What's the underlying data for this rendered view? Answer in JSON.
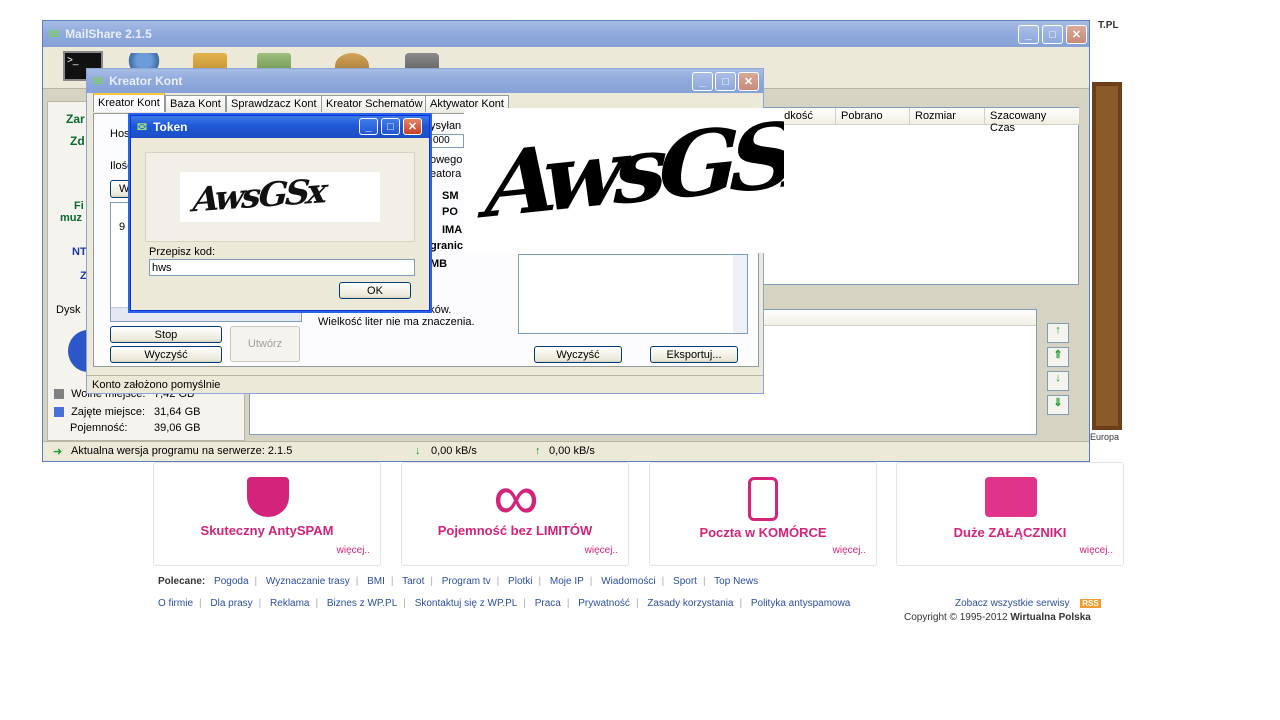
{
  "mailshare": {
    "title": "MailShare 2.1.5",
    "left_panel": {
      "links": [
        "Zar",
        "Zd",
        "Fi",
        "muz",
        "NT",
        "Z"
      ],
      "disk_label": "Dysk",
      "stats": [
        {
          "label": "Wolne miejsce:",
          "value": "7,42 GB",
          "color": "#808080"
        },
        {
          "label": "Zajęte miejsce:",
          "value": "31,64 GB",
          "color": "#4a6fd6"
        },
        {
          "label": "Pojemność:",
          "value": "39,06 GB",
          "color": ""
        }
      ]
    },
    "grid_headers": [
      "Prędkość",
      "Pobrano",
      "Rozmiar",
      "Szacowany Czas"
    ],
    "status": {
      "server_version": "Aktualna wersja programu na serwerze: 2.1.5",
      "download_speed": "0,00 kB/s",
      "upload_speed": "0,00 kB/s"
    }
  },
  "kreator": {
    "title": "Kreator Kont",
    "tabs": [
      "Kreator Kont",
      "Baza Kont",
      "Sprawdzacz Kont",
      "Kreator Schematów",
      "Aktywator Kont"
    ],
    "host_label": "Host",
    "ilosc_label": "Ilość",
    "w_button": "W",
    "row_number": "9",
    "wysylan_label": "ysyłan",
    "counter_value": "000",
    "right_texts": [
      "owego",
      "eatora"
    ],
    "options": [
      "SM",
      "PO",
      "IMA"
    ],
    "granic_label": "granic",
    "mb_label": "MB",
    "info_line1": "Token to zawsze 6 znaków.",
    "info_line2": "Wielkość liter nie ma znaczenia.",
    "buttons": {
      "stop": "Stop",
      "clear": "Wyczyść",
      "create": "Utwórz",
      "clear2": "Wyczyść",
      "export": "Eksportuj..."
    },
    "status_text": "Konto założono pomyślnie"
  },
  "token": {
    "title": "Token",
    "captcha_text": "AwsGSx",
    "input_label": "Przepisz kod:",
    "input_value": "hws",
    "ok_label": "OK"
  },
  "wp": {
    "cards": [
      {
        "title": "Skuteczny AntySPAM",
        "more": "więcej.."
      },
      {
        "title": "Pojemność bez LIMITÓW",
        "more": "więcej.."
      },
      {
        "title": "Poczta w KOMÓRCE",
        "more": "więcej.."
      },
      {
        "title": "Duże ZAŁĄCZNIKI",
        "more": "więcej.."
      }
    ],
    "recommended_label": "Polecane:",
    "recommended": [
      "Pogoda",
      "Wyznaczanie trasy",
      "BMI",
      "Tarot",
      "Program tv",
      "Plotki",
      "Moje IP",
      "Wiadomości",
      "Sport",
      "Top News"
    ],
    "footer_links": [
      "O firmie",
      "Dla prasy",
      "Reklama",
      "Biznes z WP.PL",
      "Skontaktuj się z WP.PL",
      "Praca",
      "Prywatność",
      "Zasady korzystania",
      "Polityka antyspamowa"
    ],
    "all_services": "Zobacz wszystkie serwisy",
    "rss": "RSS",
    "copyright": "Copyright © 1995-2012",
    "copyright_company": "Wirtualna Polska",
    "top_right": "T.PL",
    "side_text": "Europa"
  },
  "colors": {
    "wp_pink": "#d4237a",
    "xp_blue": "#2257d3",
    "xp_panel": "#ece9d8"
  }
}
